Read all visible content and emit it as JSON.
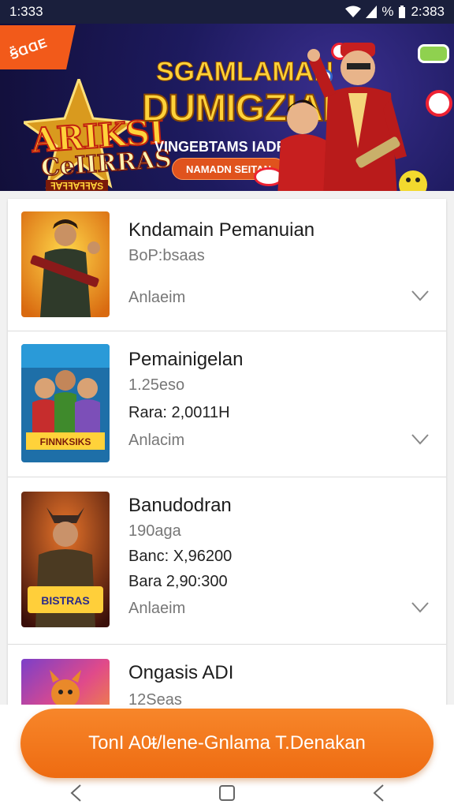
{
  "status_bar": {
    "time": "1:333",
    "battery_text": "%",
    "right_time": "2:383"
  },
  "banner": {
    "ribbon": "Ꞩ̈ⱭⱭE",
    "logo_line1": "ARIKSI",
    "logo_line2": "CeIIRRAS",
    "logo_line3": "ꟻⱯꟻꟻⱯꟻꟻⱯS",
    "title_line1": "SGAMLAMAN",
    "title_line2": "DUMIGZIAI",
    "subtitle": "VINGEBTAMS IADRGAN",
    "button": "NAMADN SEITAN"
  },
  "games": [
    {
      "name": "Kndamain Pemanuian",
      "size": "BoP:bsaas",
      "price": "",
      "price2": "",
      "action": "Anlaeim"
    },
    {
      "name": "Pemainigelan",
      "size": "1.25eso",
      "price": "Rara: 2,0011H",
      "price2": "",
      "action": "Anlacim",
      "thumb_text": "FINNKSIKS"
    },
    {
      "name": "Banudodran",
      "size": "190aga",
      "price": "Banc: X,96200",
      "price2": "Bara 2,90:300",
      "action": "Anlaeim",
      "thumb_text": "BISTRAS"
    },
    {
      "name": "Ongasis ADI",
      "size": "12Seas",
      "price": "",
      "price2": "",
      "action": ""
    }
  ],
  "cta_label": "TonI A0ᵵ/lene-Gnlama T.Denakan",
  "icons": {
    "back": "back-icon",
    "home": "home-icon",
    "recents": "recents-icon",
    "chevron": "chevron-down-icon"
  },
  "colors": {
    "accent": "#ee6b11",
    "banner_bg": "#1d1a5e"
  }
}
